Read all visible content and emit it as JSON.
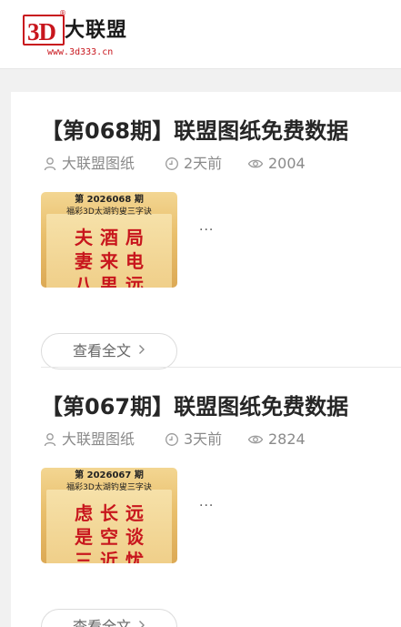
{
  "site": {
    "logo_mark": "3D",
    "logo_reg": "®",
    "logo_name": "大联盟",
    "logo_url": "www.3d333.cn"
  },
  "posts": [
    {
      "title": "【第068期】联盟图纸免费数据",
      "author": "大联盟图纸",
      "time": "2天前",
      "views": "2004",
      "excerpt": "...",
      "read_more": "查看全文",
      "thumb": {
        "issue": "第 2026068 期",
        "subtitle": "福彩3D太湖钓叟三字诀",
        "line1": "夫酒局",
        "line2": "妻来电",
        "line3": "八男远"
      }
    },
    {
      "title": "【第067期】联盟图纸免费数据",
      "author": "大联盟图纸",
      "time": "3天前",
      "views": "2824",
      "excerpt": "...",
      "read_more": "查看全文",
      "thumb": {
        "issue": "第 2026067 期",
        "subtitle": "福彩3D太湖钓叟三字诀",
        "line1": "虑长远",
        "line2": "是空谈",
        "line3": "三近忧"
      }
    }
  ]
}
